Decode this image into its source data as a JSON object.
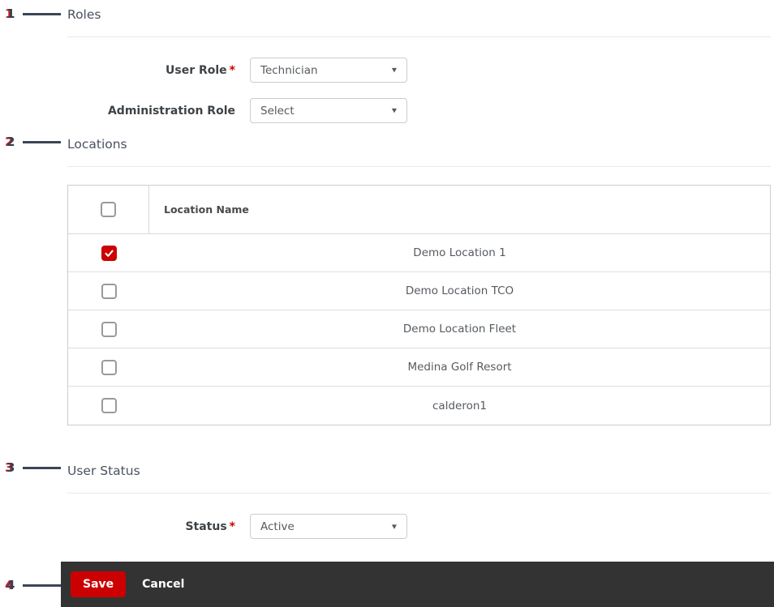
{
  "annotations": [
    {
      "number": "1"
    },
    {
      "number": "2"
    },
    {
      "number": "3"
    },
    {
      "number": "4"
    }
  ],
  "icons": {
    "select_caret": "▼"
  },
  "sections": {
    "roles": {
      "title": "Roles",
      "fields": [
        {
          "label": "User Role",
          "required_marker": "*",
          "value": "Technician"
        },
        {
          "label": "Administration Role",
          "value": "Select"
        }
      ]
    },
    "locations": {
      "title": "Locations",
      "table": {
        "name_header": "Location Name",
        "rows": [
          {
            "name": "Demo Location 1",
            "checked": true
          },
          {
            "name": "Demo Location TCO",
            "checked": false
          },
          {
            "name": "Demo Location Fleet",
            "checked": false
          },
          {
            "name": "Medina Golf Resort",
            "checked": false
          },
          {
            "name": "calderon1",
            "checked": false
          }
        ]
      }
    },
    "user_status": {
      "title": "User Status",
      "field": {
        "label": "Status",
        "required_marker": "*",
        "value": "Active"
      }
    }
  },
  "footer": {
    "save_label": "Save",
    "cancel_label": "Cancel"
  },
  "colors": {
    "accent_red": "#cc0000",
    "footer_bar": "#333333",
    "annotation_navy": "#333f50"
  }
}
